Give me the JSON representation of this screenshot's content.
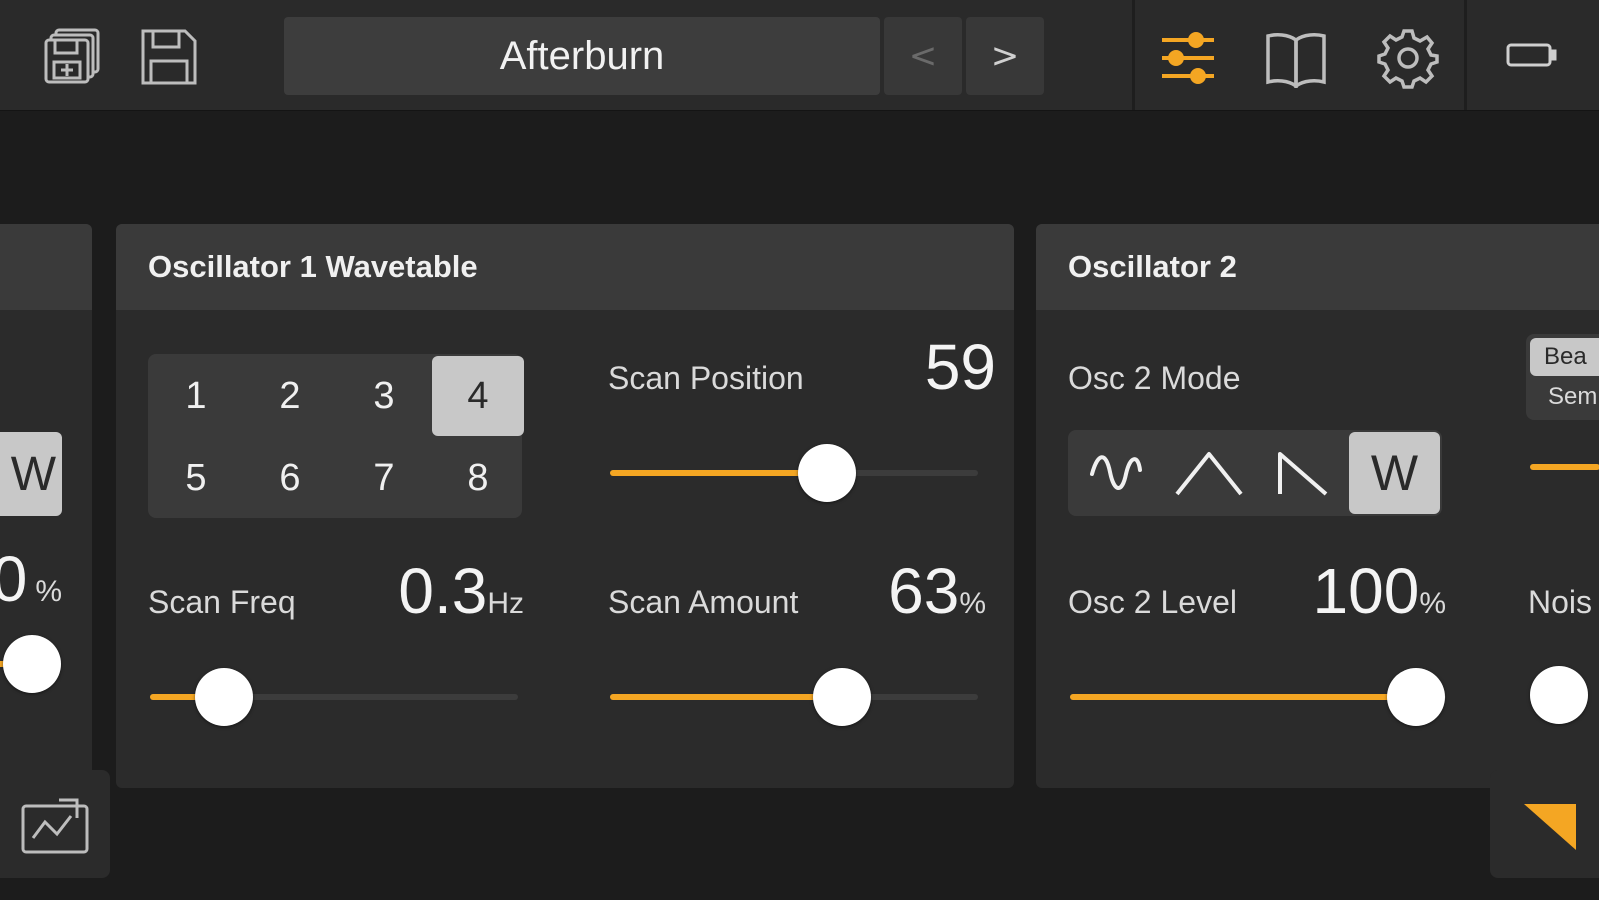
{
  "colors": {
    "accent": "#f4a623",
    "background": "#1c1c1c",
    "panel": "#2b2b2b",
    "panel_header": "#3a3a3a",
    "knob": "#ffffff"
  },
  "header": {
    "preset_name": "Afterburn",
    "prev_symbol": "<",
    "next_symbol": ">",
    "icons": [
      "save-as-icon",
      "save-icon",
      "mixer-sliders-icon",
      "manual-book-icon",
      "settings-gear-icon",
      "battery-icon"
    ]
  },
  "left_panel": {
    "mode_button": "W",
    "level_value": "0",
    "level_unit": "%",
    "level_fraction": 1.0
  },
  "osc1": {
    "title": "Oscillator 1 Wavetable",
    "wavetable_slots": [
      "1",
      "2",
      "3",
      "4",
      "5",
      "6",
      "7",
      "8"
    ],
    "selected_slot": "4",
    "scan_position": {
      "label": "Scan Position",
      "value": "59",
      "fraction": 0.59
    },
    "scan_freq": {
      "label": "Scan Freq",
      "value": "0.3",
      "unit": "Hz",
      "fraction": 0.2
    },
    "scan_amount": {
      "label": "Scan Amount",
      "value": "63",
      "unit": "%",
      "fraction": 0.63
    }
  },
  "osc2": {
    "title": "Oscillator 2",
    "mode_label": "Osc 2 Mode",
    "modes": [
      "sine-wave-icon",
      "triangle-wave-icon",
      "sawtooth-wave-icon",
      "W"
    ],
    "selected_mode": "W",
    "level": {
      "label": "Osc 2 Level",
      "value": "100",
      "unit": "%",
      "fraction": 1.0
    },
    "toggle_options": [
      "Bea",
      "Sem"
    ],
    "noise_label": "Nois"
  },
  "bottom": {
    "left_button_icon": "export-window-icon",
    "right_button_icon": "corner-triangle-icon"
  }
}
